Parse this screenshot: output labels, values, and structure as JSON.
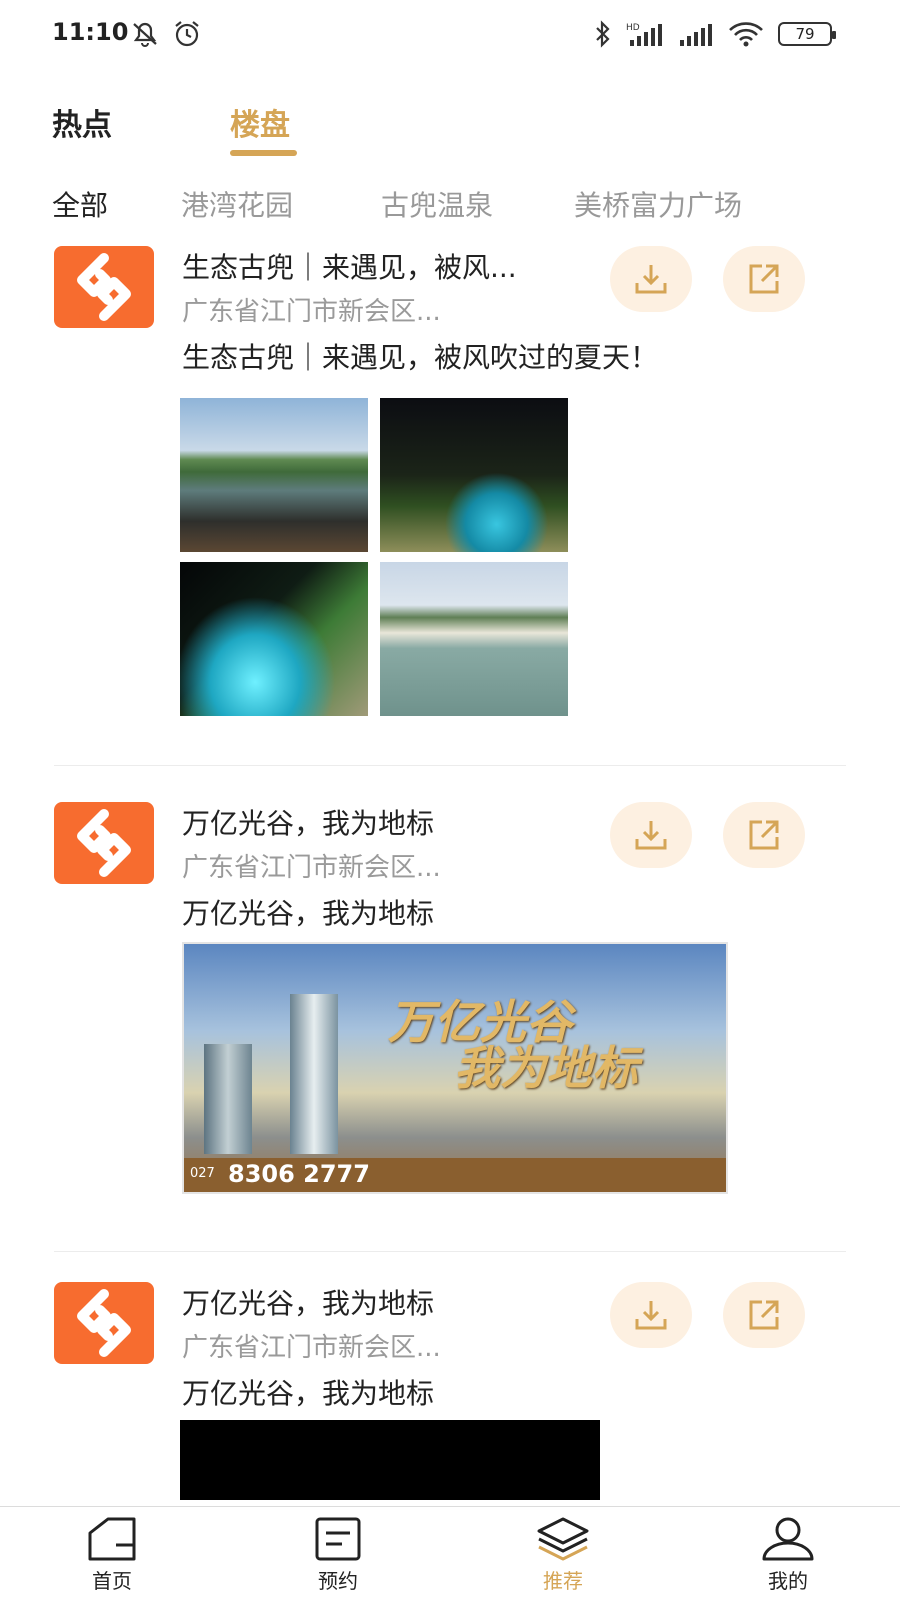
{
  "status_bar": {
    "time": "11:10",
    "battery": "79",
    "icons": [
      "mute-icon",
      "alarm-icon",
      "bluetooth-icon",
      "hd-signal-icon",
      "signal-icon",
      "wifi-icon",
      "battery-icon"
    ]
  },
  "top_tabs": [
    {
      "label": "热点",
      "active": false
    },
    {
      "label": "楼盘",
      "active": true
    }
  ],
  "filters": [
    {
      "label": "全部",
      "active": true
    },
    {
      "label": "港湾花园",
      "active": false
    },
    {
      "label": "古兜温泉",
      "active": false
    },
    {
      "label": "美桥富力广场",
      "active": false
    }
  ],
  "posts": [
    {
      "title": "生态古兜｜来遇见，被风...",
      "address": "广东省江门市新会区...",
      "text": "生态古兜｜来遇见，被风吹过的夏天！",
      "media": "photo-grid",
      "photos": [
        "lake-terrace-photo",
        "night-pool-photo",
        "night-steps-photo",
        "infinity-pool-photo"
      ]
    },
    {
      "title": "万亿光谷，我为地标",
      "address": "广东省江门市新会区...",
      "text": "万亿光谷，我为地标",
      "media": "banner",
      "banner": {
        "headline_1": "万亿光谷",
        "headline_2": "我为地标",
        "phone_prefix": "027",
        "phone": "8306 2777"
      }
    },
    {
      "title": "万亿光谷，我为地标",
      "address": "广东省江门市新会区...",
      "text": "万亿光谷，我为地标",
      "media": "video"
    }
  ],
  "bottom_nav": [
    {
      "label": "首页",
      "icon": "home-icon",
      "active": false
    },
    {
      "label": "预约",
      "icon": "appointment-icon",
      "active": false
    },
    {
      "label": "推荐",
      "icon": "layers-icon",
      "active": true
    },
    {
      "label": "我的",
      "icon": "user-icon",
      "active": false
    }
  ],
  "colors": {
    "accent": "#d5a556",
    "logo_bg": "#f76c2f",
    "action_bg": "#fdf0e1",
    "muted_text": "#9a9a9a"
  }
}
